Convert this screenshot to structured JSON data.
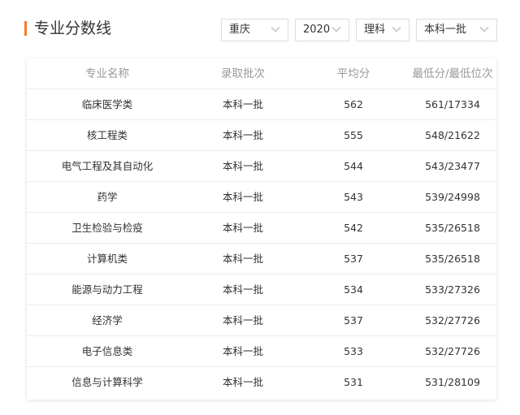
{
  "header": {
    "title": "专业分数线"
  },
  "filters": {
    "region": "重庆",
    "year": "2020",
    "subject": "理科",
    "batch": "本科一批"
  },
  "table": {
    "columns": [
      "专业名称",
      "录取批次",
      "平均分",
      "最低分/最低位次"
    ],
    "rows": [
      {
        "major": "临床医学类",
        "batch": "本科一批",
        "avg": "562",
        "min": "561/17334"
      },
      {
        "major": "核工程类",
        "batch": "本科一批",
        "avg": "555",
        "min": "548/21622"
      },
      {
        "major": "电气工程及其自动化",
        "batch": "本科一批",
        "avg": "544",
        "min": "543/23477"
      },
      {
        "major": "药学",
        "batch": "本科一批",
        "avg": "543",
        "min": "539/24998"
      },
      {
        "major": "卫生检验与检疫",
        "batch": "本科一批",
        "avg": "542",
        "min": "535/26518"
      },
      {
        "major": "计算机类",
        "batch": "本科一批",
        "avg": "537",
        "min": "535/26518"
      },
      {
        "major": "能源与动力工程",
        "batch": "本科一批",
        "avg": "534",
        "min": "533/27326"
      },
      {
        "major": "经济学",
        "batch": "本科一批",
        "avg": "537",
        "min": "532/27726"
      },
      {
        "major": "电子信息类",
        "batch": "本科一批",
        "avg": "533",
        "min": "532/27726"
      },
      {
        "major": "信息与计算科学",
        "batch": "本科一批",
        "avg": "531",
        "min": "531/28109"
      }
    ]
  },
  "colors": {
    "accent": "#f47b2a",
    "header_text": "#999999",
    "body_text": "#333333"
  }
}
